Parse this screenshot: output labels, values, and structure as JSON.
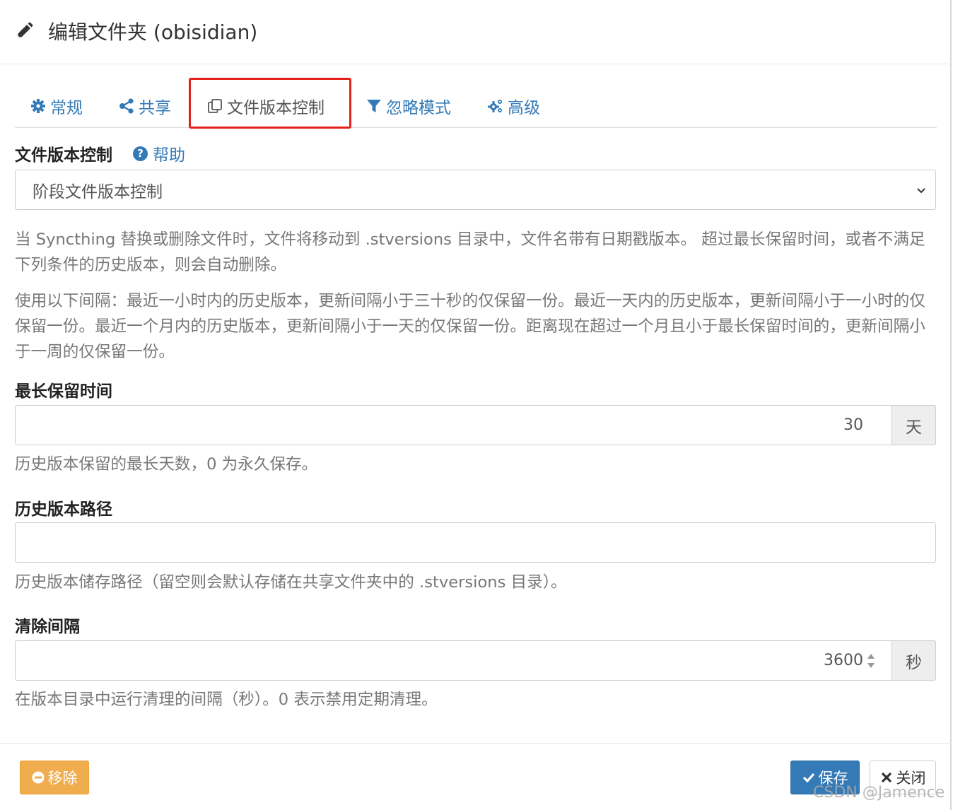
{
  "header": {
    "title": "编辑文件夹 (obisidian)",
    "icon": "pencil-icon"
  },
  "tabs": [
    {
      "label": "常规",
      "icon": "gear-icon"
    },
    {
      "label": "共享",
      "icon": "share-icon"
    },
    {
      "label": "文件版本控制",
      "icon": "copy-icon"
    },
    {
      "label": "忽略模式",
      "icon": "filter-icon"
    },
    {
      "label": "高级",
      "icon": "gears-icon"
    }
  ],
  "active_tab": "文件版本控制",
  "highlight_color": "#e3221b",
  "versioning": {
    "label": "文件版本控制",
    "help_label": "帮助",
    "selected": "阶段文件版本控制",
    "description1": "当 Syncthing 替换或删除文件时，文件将移动到 .stversions 目录中，文件名带有日期戳版本。 超过最长保留时间，或者不满足下列条件的历史版本，则会自动删除。",
    "description2": "使用以下间隔：最近一小时内的历史版本，更新间隔小于三十秒的仅保留一份。最近一天内的历史版本，更新间隔小于一小时的仅保留一份。最近一个月内的历史版本，更新间隔小于一天的仅保留一份。距离现在超过一个月且小于最长保留时间的，更新间隔小于一周的仅保留一份。"
  },
  "max_age": {
    "label": "最长保留时间",
    "value": "30",
    "unit": "天",
    "help": "历史版本保留的最长天数，0 为永久保存。"
  },
  "versions_path": {
    "label": "历史版本路径",
    "value": "",
    "help": "历史版本储存路径（留空则会默认存储在共享文件夹中的 .stversions 目录）。"
  },
  "cleanup_interval": {
    "label": "清除间隔",
    "value": "3600",
    "unit": "秒",
    "help": "在版本目录中运行清理的间隔（秒）。0 表示禁用定期清理。"
  },
  "footer": {
    "remove_label": "移除",
    "save_label": "保存",
    "close_label": "关闭"
  },
  "colors": {
    "link": "#337ab7",
    "warning": "#f0ad4e",
    "primary": "#337ab7"
  },
  "watermark": "CSDN @Jamence"
}
